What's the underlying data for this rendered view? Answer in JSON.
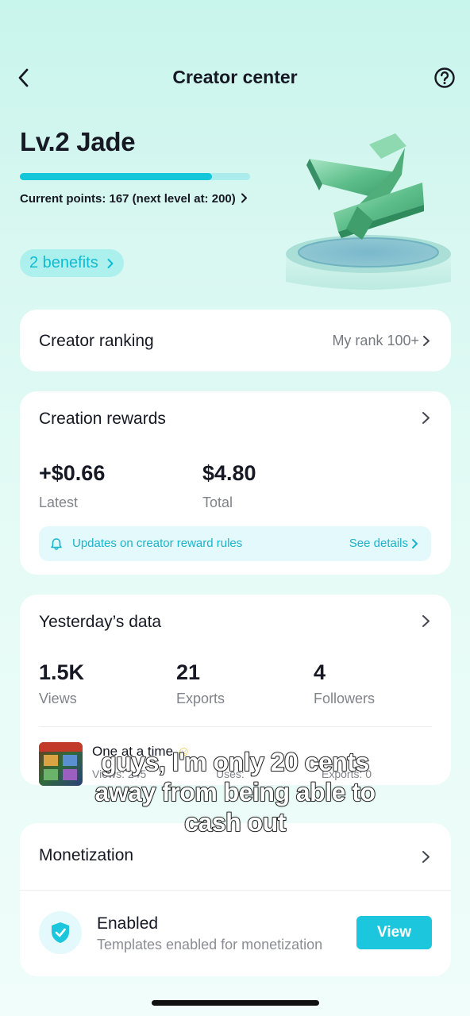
{
  "header": {
    "title": "Creator center"
  },
  "level": {
    "label": "Lv.2 Jade",
    "progress_fraction": 0.835,
    "points_text": "Current points: 167 (next level at: 200)",
    "benefits_label": "2 benefits"
  },
  "ranking": {
    "title": "Creator ranking",
    "rank_text": "My rank 100+"
  },
  "rewards": {
    "title": "Creation rewards",
    "latest_value": "+$0.66",
    "latest_label": "Latest",
    "total_value": "$4.80",
    "total_label": "Total",
    "notice_text": "Updates on creator reward rules",
    "notice_link": "See details"
  },
  "yesterday": {
    "title": "Yesterday’s data",
    "stats": [
      {
        "value": "1.5K",
        "label": "Views"
      },
      {
        "value": "21",
        "label": "Exports"
      },
      {
        "value": "4",
        "label": "Followers"
      }
    ],
    "template": {
      "title": "One at a time",
      "views": "Views: 245",
      "uses": "Uses: ",
      "exports": "Exports: 0"
    }
  },
  "caption": {
    "lines": [
      "guys, I'm only 20 cents",
      "away from being able to",
      "cash out"
    ]
  },
  "monetization": {
    "title": "Monetization",
    "status": "Enabled",
    "subtitle": "Templates enabled for monetization",
    "button": "View"
  },
  "colors": {
    "accent": "#1cc6dc",
    "progress_track": "#9be9ee",
    "background_top": "#c8f5ec"
  }
}
